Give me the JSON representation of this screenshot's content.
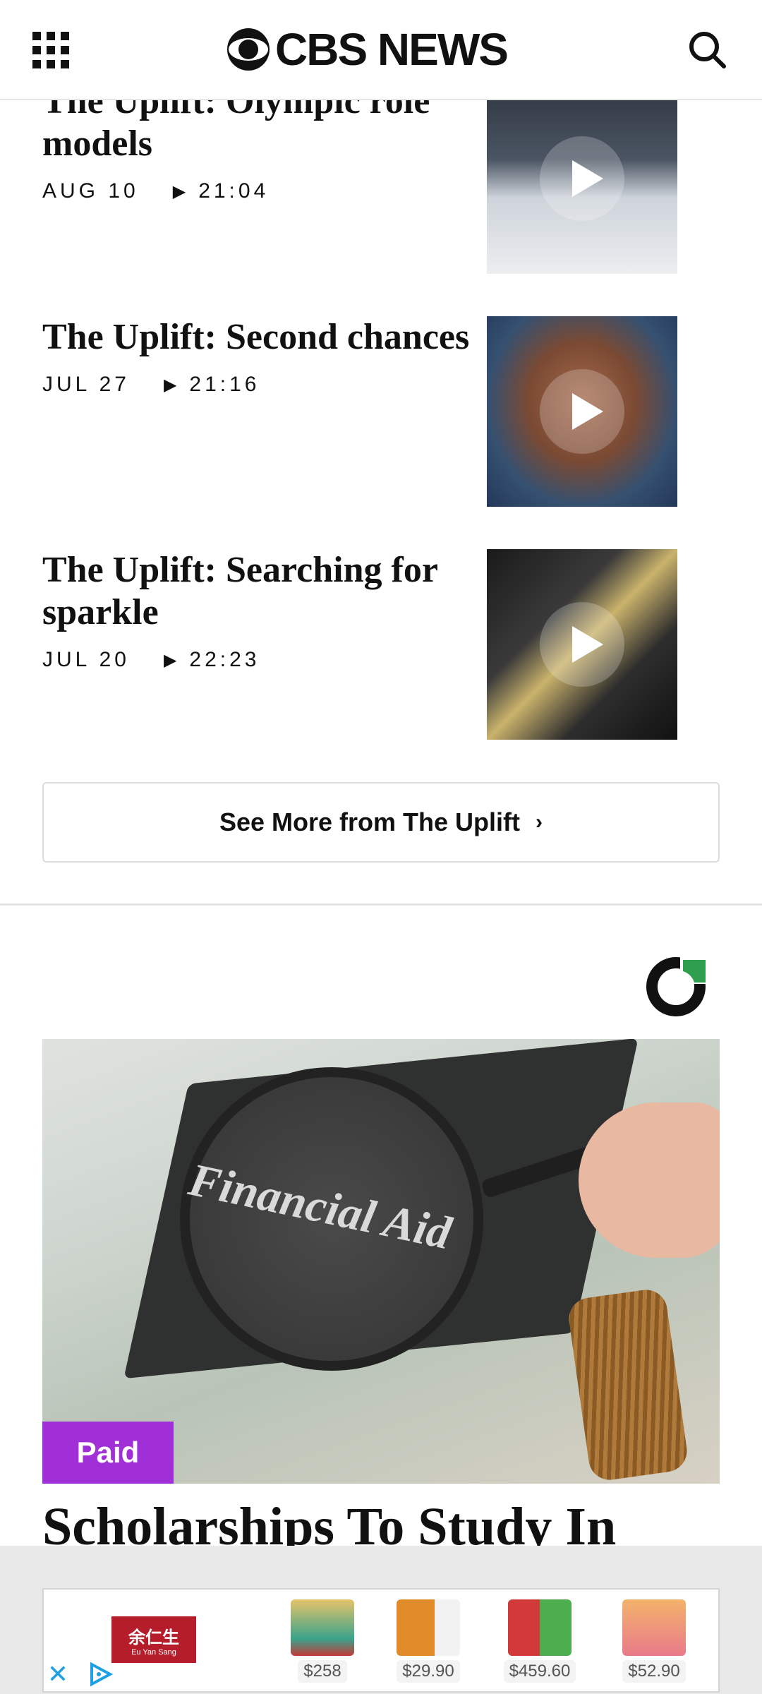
{
  "header": {
    "logo_text": "CBS NEWS",
    "menu_icon": "grid-menu-icon",
    "search_icon": "search-icon"
  },
  "articles": [
    {
      "title": "The Uplift: Olympic role models",
      "date": "AUG 10",
      "duration": "21:04"
    },
    {
      "title": "The Uplift: Second chances",
      "date": "JUL 27",
      "duration": "21:16"
    },
    {
      "title": "The Uplift: Searching for sparkle",
      "date": "JUL 20",
      "duration": "22:23"
    }
  ],
  "see_more": {
    "label": "See More from The Uplift",
    "chevron": "›"
  },
  "sponsored": {
    "image_text": "Financial Aid",
    "badge": "Paid",
    "headline": "Scholarships To Study In",
    "badge_color": "#a02fd8"
  },
  "banner_ad": {
    "brand_cn": "余仁生",
    "brand_en": "Eu Yan Sang",
    "prices": [
      "$258",
      "$29.90",
      "$459.60",
      "$52.90"
    ],
    "close_icon": "close-icon",
    "adchoices_icon": "adchoices-icon"
  }
}
